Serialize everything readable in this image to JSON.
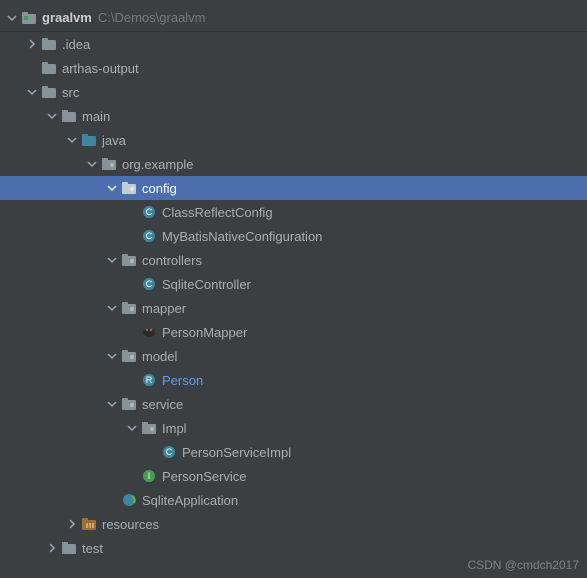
{
  "root": {
    "name": "graalvm",
    "path": "C:\\Demos\\graalvm"
  },
  "nodes": {
    "idea": ".idea",
    "arthas": "arthas-output",
    "src": "src",
    "main": "main",
    "java": "java",
    "org_example": "org.example",
    "config": "config",
    "classReflect": "ClassReflectConfig",
    "mybatis": "MyBatisNativeConfiguration",
    "controllers": "controllers",
    "sqliteController": "SqliteController",
    "mapper": "mapper",
    "personMapper": "PersonMapper",
    "model": "model",
    "person": "Person",
    "service": "service",
    "impl": "Impl",
    "personServiceImpl": "PersonServiceImpl",
    "personService": "PersonService",
    "sqliteApplication": "SqliteApplication",
    "resources": "resources",
    "test": "test"
  },
  "watermark": "CSDN @cmdch2017"
}
